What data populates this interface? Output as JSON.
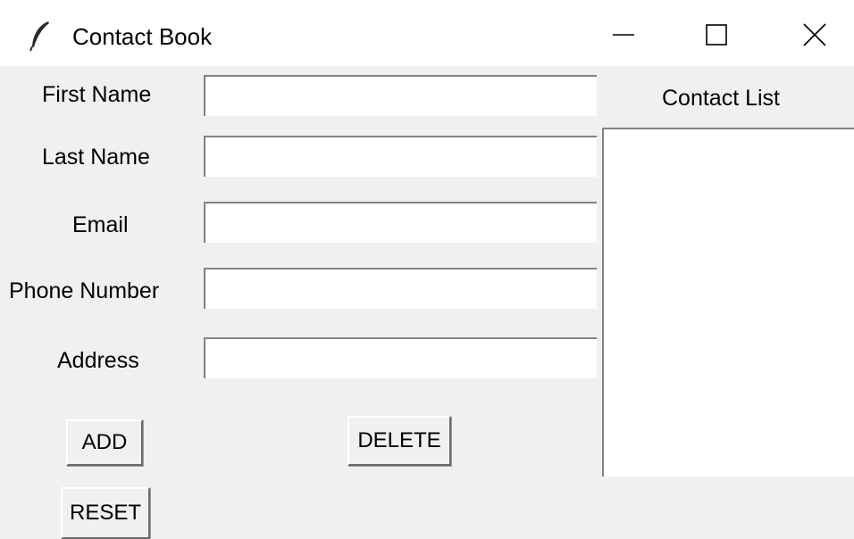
{
  "window": {
    "title": "Contact Book",
    "controls": {
      "minimize": "minimize-icon",
      "maximize": "maximize-icon",
      "close": "close-icon"
    }
  },
  "form": {
    "fields": [
      {
        "label": "First Name",
        "value": ""
      },
      {
        "label": "Last Name",
        "value": ""
      },
      {
        "label": "Email",
        "value": ""
      },
      {
        "label": "Phone Number",
        "value": ""
      },
      {
        "label": "Address",
        "value": ""
      }
    ]
  },
  "buttons": {
    "add": "ADD",
    "delete": "DELETE",
    "reset": "RESET"
  },
  "contact_list": {
    "label": "Contact List",
    "items": []
  },
  "colors": {
    "window_background": "#f0f0f0",
    "titlebar_background": "#ffffff",
    "entry_background": "#ffffff",
    "border": "#838383"
  }
}
